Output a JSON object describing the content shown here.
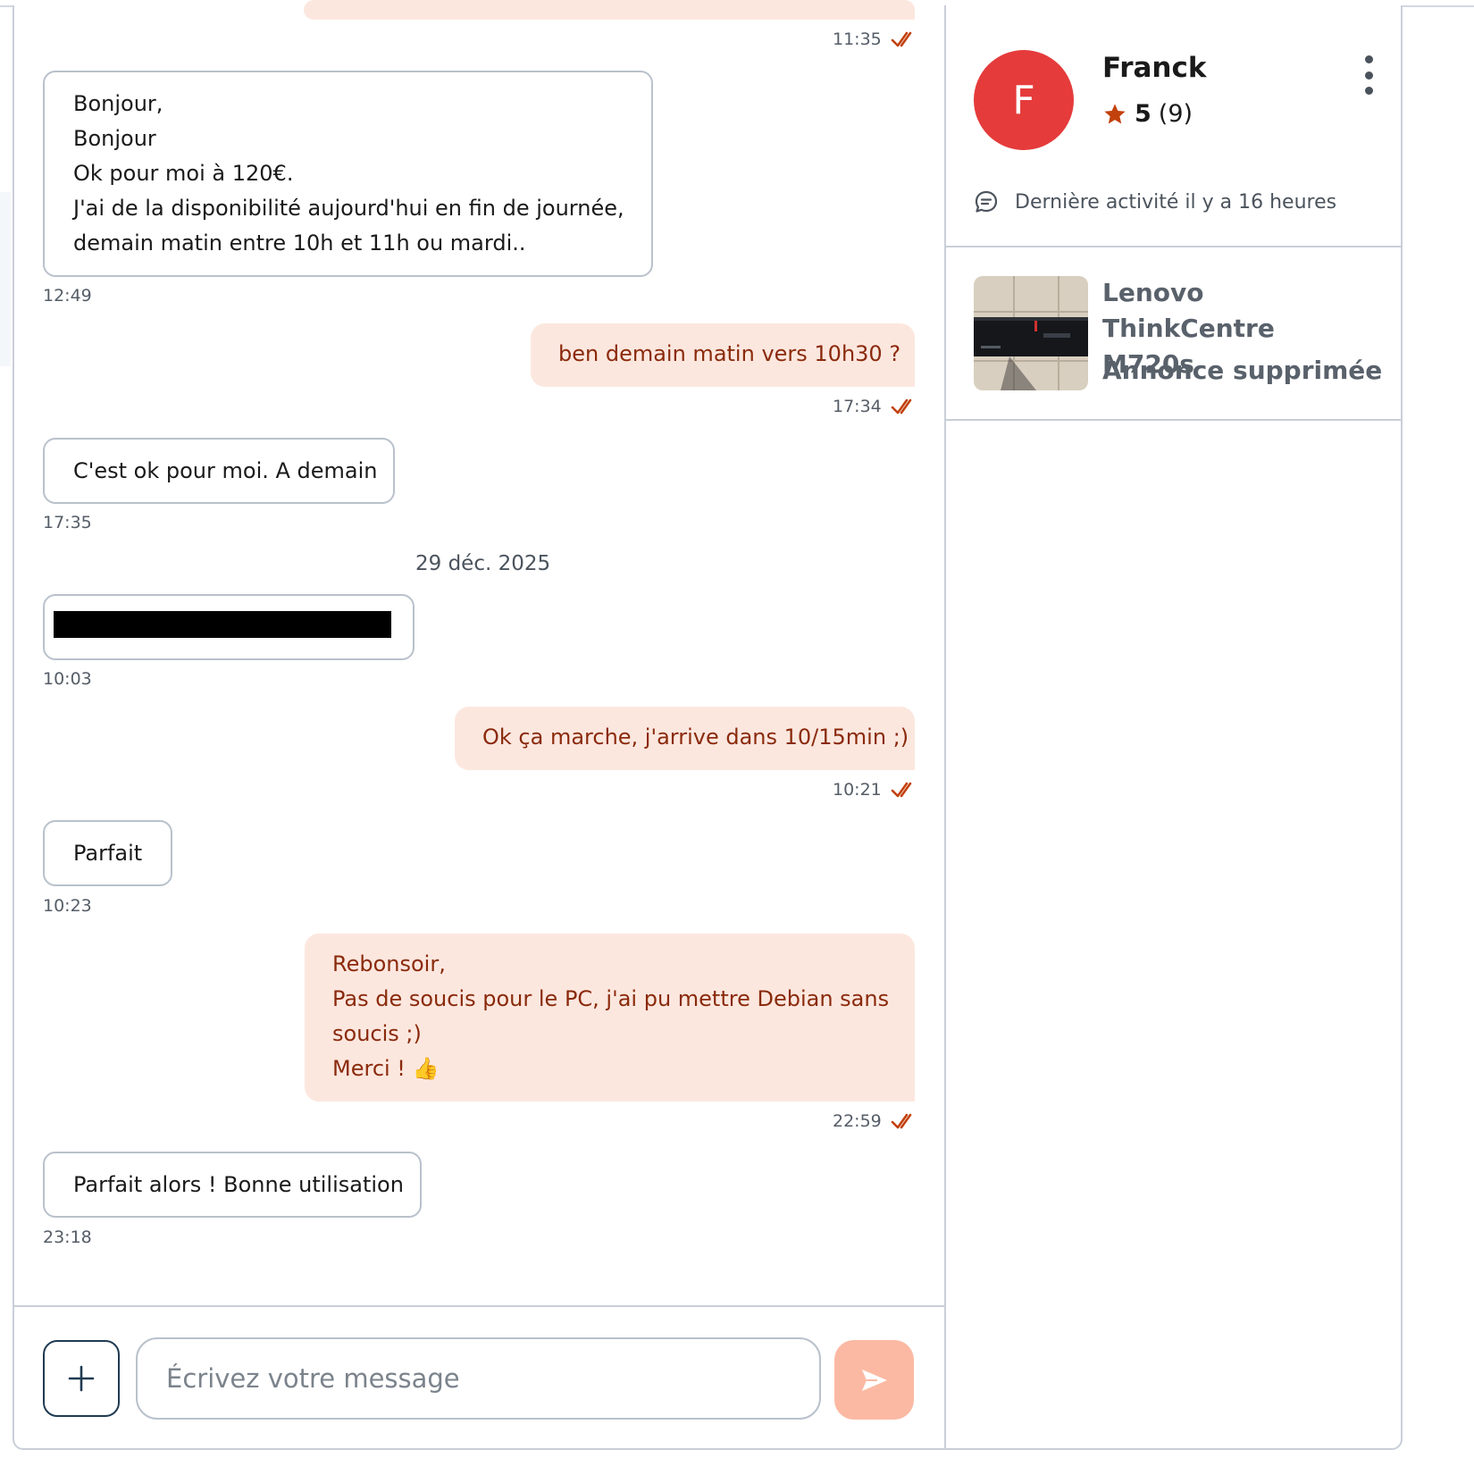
{
  "conversation": {
    "messages": [
      {
        "id": "m0",
        "direction": "out",
        "time": "11:35",
        "lines": []
      },
      {
        "id": "m1",
        "direction": "in",
        "time": "12:49",
        "lines": [
          "Bonjour,",
          "Bonjour",
          "Ok pour moi à 120€.",
          "J'ai de la disponibilité aujourd'hui en fin de journée,",
          "demain matin entre 10h et 11h ou mardi.."
        ]
      },
      {
        "id": "m2",
        "direction": "out",
        "time": "17:34",
        "lines": [
          "ben demain matin vers 10h30 ?"
        ]
      },
      {
        "id": "m3",
        "direction": "in",
        "time": "17:35",
        "lines": [
          "C'est ok pour moi. A demain"
        ]
      },
      {
        "id": "m4",
        "direction": "in",
        "time": "10:03",
        "redacted": true,
        "lines": []
      },
      {
        "id": "m5",
        "direction": "out",
        "time": "10:21",
        "lines": [
          "Ok ça marche, j'arrive dans 10/15min ;)"
        ]
      },
      {
        "id": "m6",
        "direction": "in",
        "time": "10:23",
        "lines": [
          "Parfait"
        ]
      },
      {
        "id": "m7",
        "direction": "out",
        "time": "22:59",
        "lines": [
          "Rebonsoir,",
          "Pas de soucis pour le PC, j'ai pu mettre Debian sans",
          "soucis ;)",
          "Merci ! 👍"
        ]
      },
      {
        "id": "m8",
        "direction": "in",
        "time": "23:18",
        "lines": [
          "Parfait alors ! Bonne utilisation"
        ]
      }
    ],
    "date_separator": "29 déc. 2025"
  },
  "composer": {
    "placeholder": "Écrivez votre message",
    "attach_icon": "plus-icon",
    "send_icon": "send-icon"
  },
  "profile": {
    "initial": "F",
    "name": "Franck",
    "rating": "5",
    "reviews": "(9)",
    "activity": "Dernière activité il y a 16 heures",
    "avatar_color": "#e53b3b",
    "star_color": "#c2410c"
  },
  "listing": {
    "title": "Lenovo ThinkCentre M720s",
    "status": "Annonce supprimée"
  },
  "colors": {
    "outgoing_bubble": "#fce7df",
    "outgoing_text": "#8a2a0b",
    "send_button": "#fbb9a3",
    "read_check": "#c2410c"
  }
}
